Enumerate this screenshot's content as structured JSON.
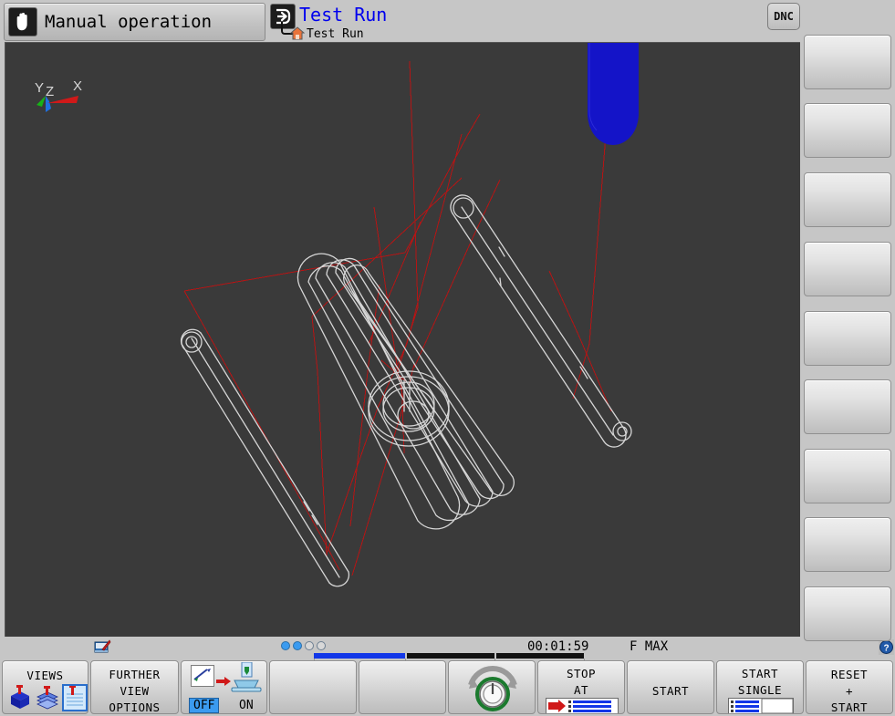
{
  "header": {
    "mode_label": "Manual operation",
    "mode_icon": "hand-icon",
    "run_title": "Test Run",
    "run_icon": "arrow-into-box-icon",
    "run_sub": "Test Run",
    "run_sub_icon": "home-icon",
    "dnc_label": "DNC",
    "clock_icon": "clock-icon"
  },
  "viewport": {
    "axis_x": "X",
    "axis_y": "Y",
    "axis_z": "Z",
    "background_color": "#3a3a3a",
    "wireframe_color": "#d6d6d6",
    "toolpath_color": "#b51414",
    "tool_color": "#1414c8"
  },
  "status": {
    "edit_icon": "program-edit-icon",
    "dots": [
      true,
      true,
      false,
      false
    ],
    "time": "00:01:59",
    "feed": "F MAX",
    "help_icon": "help-icon"
  },
  "progress": {
    "segments": [
      {
        "filled": true,
        "color": "#1237e8"
      },
      {
        "filled": false,
        "color": "#111111"
      },
      {
        "filled": false,
        "color": "#111111"
      }
    ]
  },
  "softkeys": [
    {
      "name": "views",
      "lines": [
        "VIEWS"
      ],
      "icons": [
        "solid-view-icon",
        "layered-view-icon",
        "wireframe-view-icon"
      ],
      "selected_icon_index": 2
    },
    {
      "name": "further-view-options",
      "lines": [
        "FURTHER",
        "VIEW",
        "OPTIONS"
      ]
    },
    {
      "name": "tool-workpiece-toggle",
      "icons": [
        "tool-icon",
        "arrow-right-icon",
        "workpiece-table-icon"
      ],
      "toggle_off_label": "OFF",
      "toggle_on_label": "ON",
      "toggle_state": "OFF"
    },
    {
      "name": "blank-1",
      "lines": []
    },
    {
      "name": "blank-2",
      "lines": []
    },
    {
      "name": "feed-override",
      "icons": [
        "override-dial-icon"
      ]
    },
    {
      "name": "stop-at",
      "lines": [
        "STOP",
        "AT"
      ],
      "icons": [
        "stop-at-block-icon"
      ]
    },
    {
      "name": "start",
      "lines": [
        "START"
      ]
    },
    {
      "name": "start-single",
      "lines": [
        "START",
        "SINGLE"
      ],
      "icons": [
        "single-block-icon"
      ]
    },
    {
      "name": "reset-start",
      "lines": [
        "RESET",
        "+",
        "START"
      ]
    }
  ],
  "vertical_softkeys": [
    {
      "name": "vsk-1",
      "label": ""
    },
    {
      "name": "vsk-2",
      "label": ""
    },
    {
      "name": "vsk-3",
      "label": ""
    },
    {
      "name": "vsk-4",
      "label": ""
    },
    {
      "name": "vsk-5",
      "label": ""
    },
    {
      "name": "vsk-6",
      "label": ""
    },
    {
      "name": "vsk-7",
      "label": ""
    },
    {
      "name": "vsk-8",
      "label": ""
    },
    {
      "name": "vsk-9",
      "label": ""
    }
  ]
}
